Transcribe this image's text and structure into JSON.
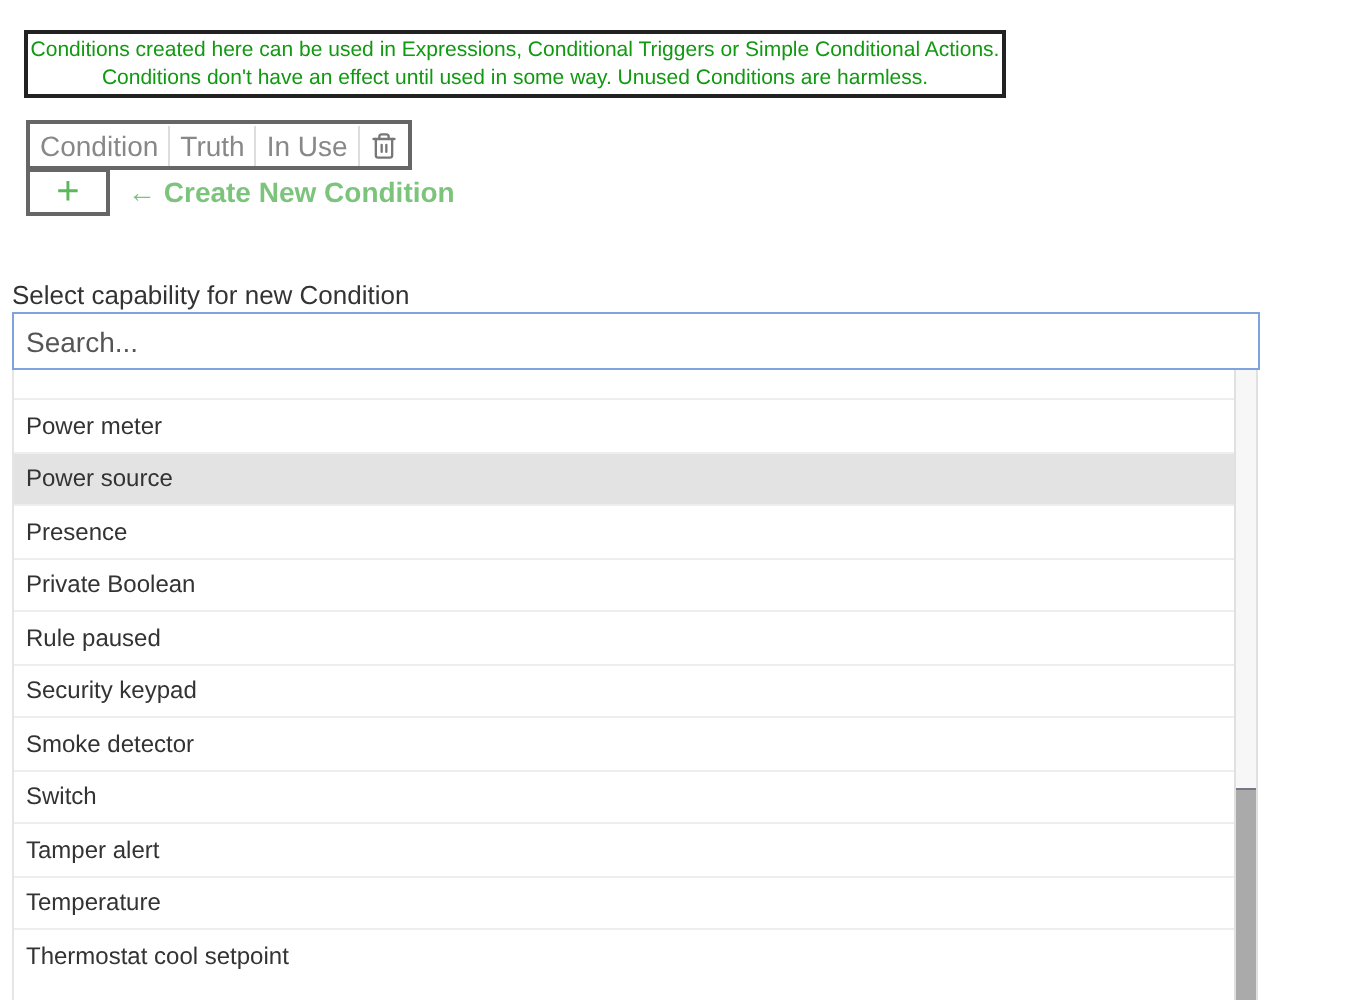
{
  "notice": [
    "Conditions created here can be used in Expressions, Conditional Triggers or Simple Conditional Actions.",
    "Conditions don't have an effect until used in some way.  Unused Conditions are harmless."
  ],
  "table": {
    "columns": [
      "Condition",
      "Truth",
      "In Use"
    ]
  },
  "add_button": "+",
  "create_label": "← Create New Condition",
  "select_label": "Select capability for new Condition",
  "search": {
    "placeholder": "Search..."
  },
  "options": [
    {
      "label": "Power meter",
      "selected": false
    },
    {
      "label": "Power source",
      "selected": true
    },
    {
      "label": "Presence",
      "selected": false
    },
    {
      "label": "Private Boolean",
      "selected": false
    },
    {
      "label": "Rule paused",
      "selected": false
    },
    {
      "label": "Security keypad",
      "selected": false
    },
    {
      "label": "Smoke detector",
      "selected": false
    },
    {
      "label": "Switch",
      "selected": false
    },
    {
      "label": "Tamper alert",
      "selected": false
    },
    {
      "label": "Temperature",
      "selected": false
    },
    {
      "label": "Thermostat cool setpoint",
      "selected": false
    }
  ]
}
